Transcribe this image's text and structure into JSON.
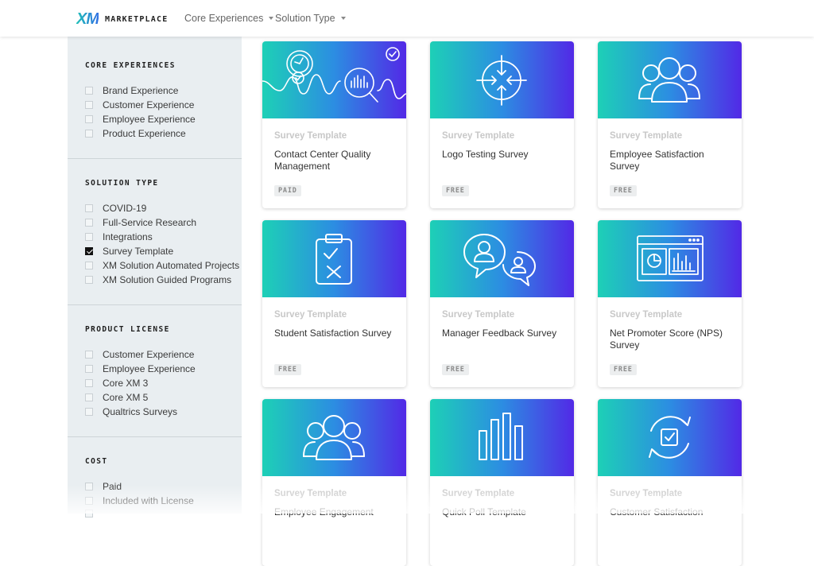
{
  "header": {
    "logo_mark": "XM",
    "logo_text": "MARKETPLACE",
    "nav": [
      {
        "label": "Core Experiences"
      },
      {
        "label": "Solution Type"
      }
    ]
  },
  "sidebar": {
    "sections": [
      {
        "title": "CORE EXPERIENCES",
        "options": [
          {
            "label": "Brand Experience",
            "checked": false
          },
          {
            "label": "Customer Experience",
            "checked": false
          },
          {
            "label": "Employee Experience",
            "checked": false
          },
          {
            "label": "Product Experience",
            "checked": false
          }
        ]
      },
      {
        "title": "SOLUTION TYPE",
        "options": [
          {
            "label": "COVID-19",
            "checked": false
          },
          {
            "label": "Full-Service Research",
            "checked": false
          },
          {
            "label": "Integrations",
            "checked": false
          },
          {
            "label": "Survey Template",
            "checked": true
          },
          {
            "label": "XM Solution Automated Projects",
            "checked": false
          },
          {
            "label": "XM Solution Guided Programs",
            "checked": false
          }
        ]
      },
      {
        "title": "PRODUCT LICENSE",
        "options": [
          {
            "label": "Customer Experience",
            "checked": false
          },
          {
            "label": "Employee Experience",
            "checked": false
          },
          {
            "label": "Core XM 3",
            "checked": false
          },
          {
            "label": "Core XM 5",
            "checked": false
          },
          {
            "label": "Qualtrics Surveys",
            "checked": false
          }
        ]
      },
      {
        "title": "COST",
        "options": [
          {
            "label": "Paid",
            "checked": false
          },
          {
            "label": "Included with License",
            "checked": false
          },
          {
            "label": "",
            "checked": false
          }
        ]
      }
    ]
  },
  "cards": [
    {
      "type": "Survey Template",
      "title": "Contact Center Quality Management",
      "badge": "PAID",
      "icon": "gauge-magnifier-icon"
    },
    {
      "type": "Survey Template",
      "title": "Logo Testing Survey",
      "badge": "FREE",
      "icon": "focus-arrows-icon"
    },
    {
      "type": "Survey Template",
      "title": "Employee Satisfaction Survey",
      "badge": "FREE",
      "icon": "people-group-icon"
    },
    {
      "type": "Survey Template",
      "title": "Student Satisfaction Survey",
      "badge": "FREE",
      "icon": "clipboard-checklist-icon"
    },
    {
      "type": "Survey Template",
      "title": "Manager Feedback Survey",
      "badge": "FREE",
      "icon": "chat-bubbles-user-icon"
    },
    {
      "type": "Survey Template",
      "title": "Net Promoter Score (NPS) Survey",
      "badge": "FREE",
      "icon": "dashboard-window-icon"
    },
    {
      "type": "Survey Template",
      "title": "Employee Engagement",
      "badge": "",
      "icon": "people-group-icon"
    },
    {
      "type": "Survey Template",
      "title": "Quick Poll Template",
      "badge": "",
      "icon": "bar-chart-icon"
    },
    {
      "type": "Survey Template",
      "title": "Customer Satisfaction",
      "badge": "",
      "icon": "refresh-check-icon"
    }
  ]
}
